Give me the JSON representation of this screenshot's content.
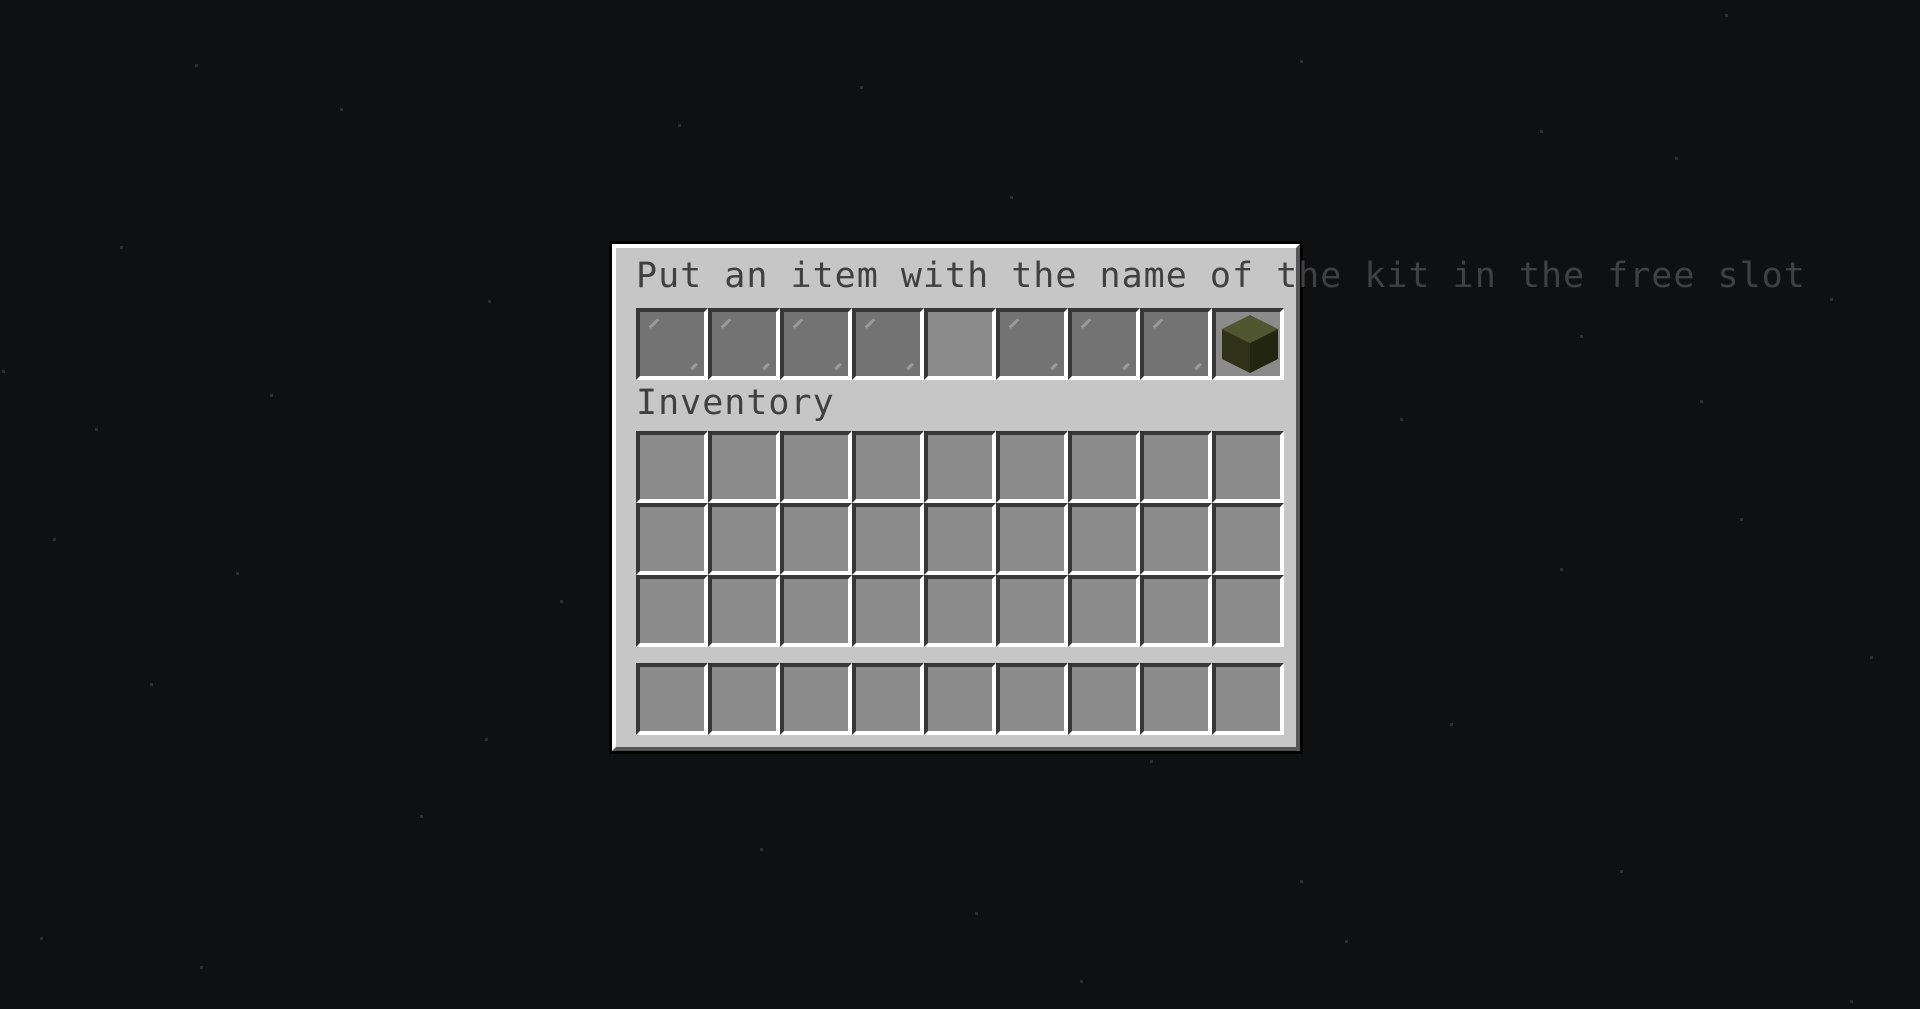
{
  "container": {
    "title": "Put an item with the name of the kit in the free slot",
    "inventory_label": "Inventory"
  },
  "kit_row": {
    "slots": [
      {
        "item": "glass-pane-icon"
      },
      {
        "item": "glass-pane-icon"
      },
      {
        "item": "glass-pane-icon"
      },
      {
        "item": "glass-pane-icon"
      },
      {
        "item": null,
        "free": true
      },
      {
        "item": "glass-pane-icon"
      },
      {
        "item": "glass-pane-icon"
      },
      {
        "item": "glass-pane-icon"
      },
      {
        "item": "dark-green-block-icon"
      }
    ]
  },
  "inventory": {
    "rows": 3,
    "columns": 9,
    "hotbar_slots": 9
  },
  "colors": {
    "background": "#0e1011",
    "panel": "#c6c6c6",
    "slot": "#8b8b8b",
    "glass_slot": "#737373",
    "text": "#404040",
    "block_top": "#4f5630",
    "block_left": "#2f3219",
    "block_right": "#22250f"
  }
}
